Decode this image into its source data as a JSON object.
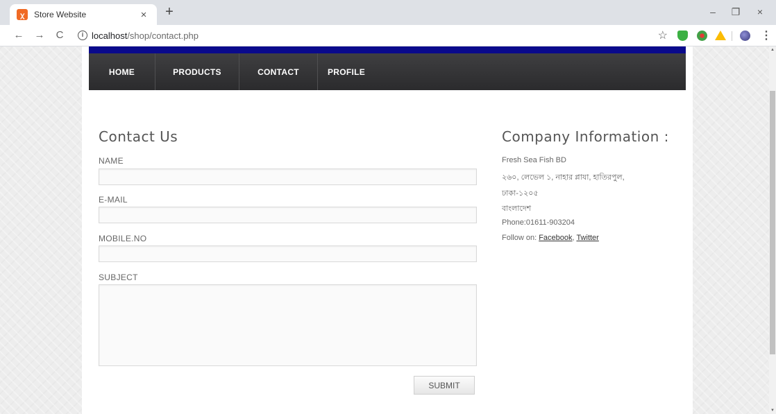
{
  "browser": {
    "tab_title": "Store Website",
    "tab_favicon": "xampp-icon",
    "tab_close": "×",
    "new_tab": "+",
    "url_host": "localhost",
    "url_path": "/shop/contact.php",
    "window_controls": {
      "minimize": "–",
      "maximize": "❐",
      "close": "×"
    },
    "nav_icons": {
      "back": "←",
      "forward": "→",
      "reload": "C"
    }
  },
  "nav": {
    "items": [
      "HOME",
      "PRODUCTS",
      "CONTACT",
      "PROFILE"
    ]
  },
  "contact": {
    "title": "Contact Us",
    "name_label": "NAME",
    "email_label": "E-MAIL",
    "mobile_label": "MOBILE.NO",
    "subject_label": "SUBJECT",
    "submit_label": "SUBMIT"
  },
  "company": {
    "title": "Company Information :",
    "name": "Fresh Sea Fish BD",
    "address_line1": "২৬০, লেভেল ১, নাহার প্লাযা, হাতিরপুল,",
    "address_line2": "ঢাকা-১২০৫",
    "country": "বাংলাদেশ",
    "phone": "Phone:01611-903204",
    "follow_prefix": "Follow on: ",
    "facebook": "Facebook",
    "separator": ", ",
    "twitter": "Twitter"
  },
  "colors": {
    "top_bar": "#0a0a8c",
    "nav_bg": "#333335"
  }
}
